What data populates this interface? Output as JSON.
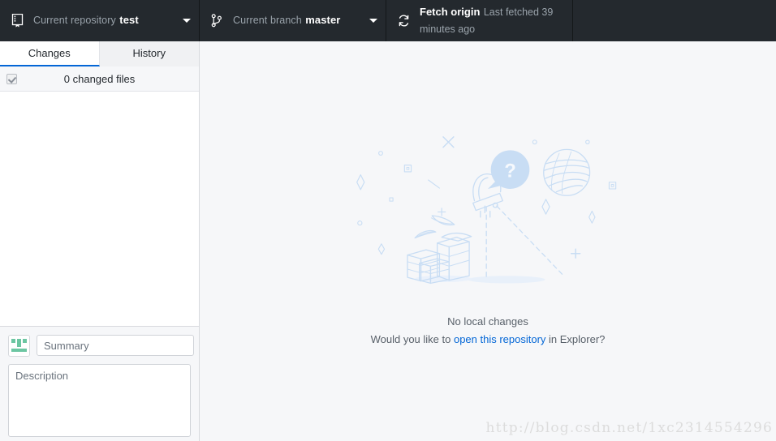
{
  "toolbar": {
    "repository": {
      "icon": "repo-book-icon",
      "label": "Current repository",
      "value": "test",
      "caret": "chevron-down-icon"
    },
    "branch": {
      "icon": "git-branch-icon",
      "label": "Current branch",
      "value": "master",
      "caret": "chevron-down-icon"
    },
    "fetch": {
      "icon": "sync-refresh-icon",
      "title": "Fetch origin",
      "subtitle": "Last fetched 39 minutes ago"
    }
  },
  "sidebar": {
    "tabs": [
      {
        "label": "Changes",
        "active": true
      },
      {
        "label": "History",
        "active": false
      }
    ],
    "changed_files": {
      "checkbox_checked": true,
      "label": "0 changed files"
    },
    "commit": {
      "avatar_icon": "identicon-avatar",
      "summary_placeholder": "Summary",
      "summary_value": "",
      "description_placeholder": "Description",
      "description_value": ""
    }
  },
  "main": {
    "illustration_name": "telescope-blank-slate-illustration",
    "title": "No local changes",
    "question_prefix": "Would you like to ",
    "link_text": "open this repository",
    "question_suffix": " in Explorer?"
  },
  "watermark": {
    "text": "http://blog.csdn.net/1xc2314554296"
  },
  "colors": {
    "toolbar_bg": "#24292e",
    "accent_blue": "#0366d6",
    "panel_bg": "#f6f7f9",
    "illustration_blue": "#c8ddf4",
    "avatar_green": "#6cc6a2"
  }
}
